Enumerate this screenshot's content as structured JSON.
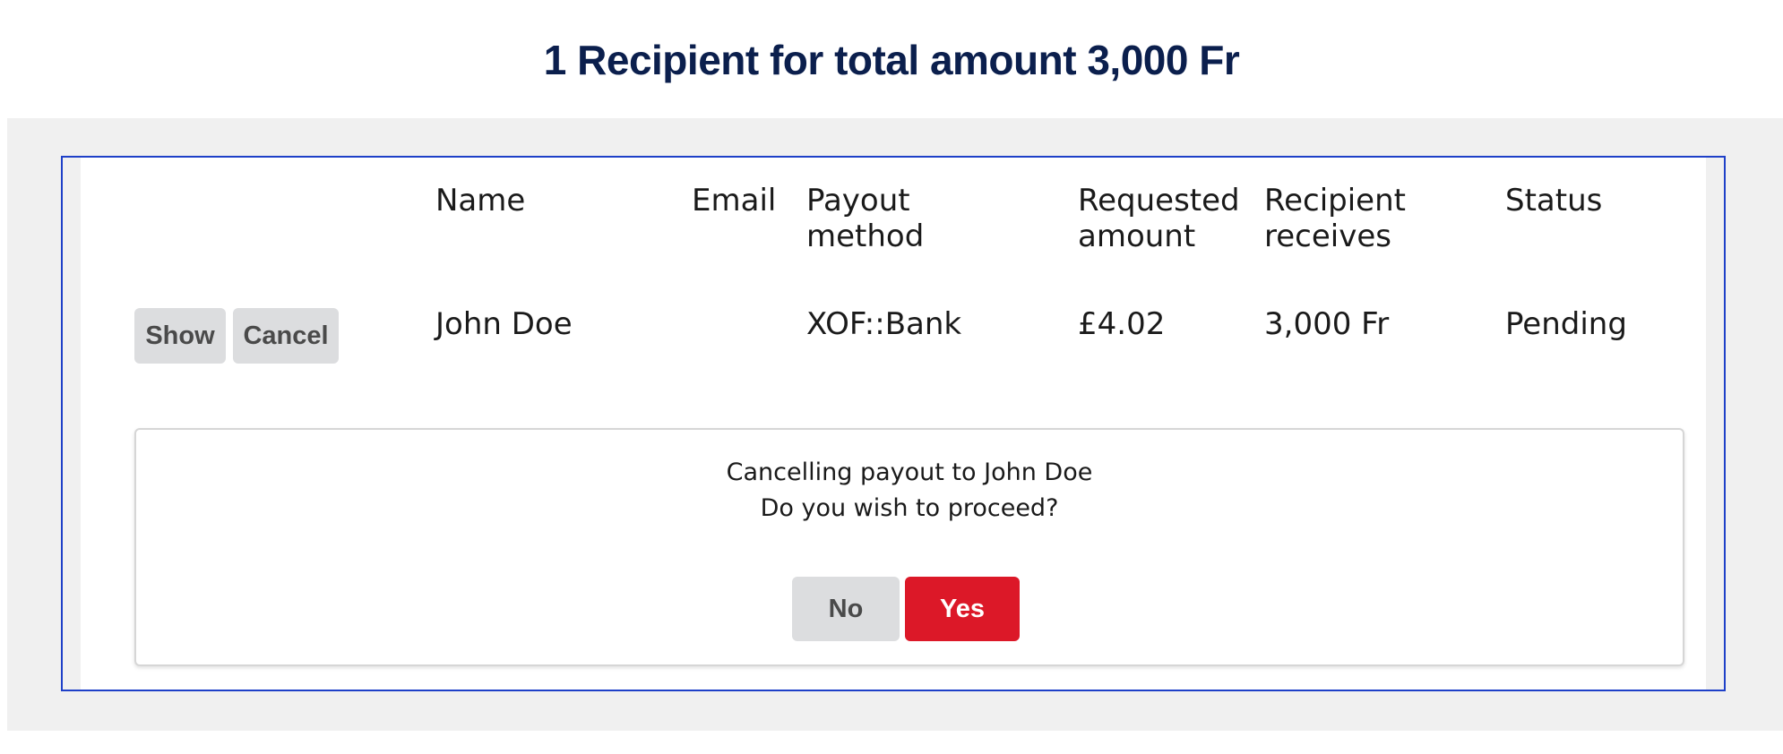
{
  "header": {
    "title": "1 Recipient for total amount 3,000 Fr"
  },
  "table": {
    "columns": {
      "name": "Name",
      "email": "Email",
      "payout_method": [
        "Payout",
        "method"
      ],
      "requested_amount": [
        "Requested",
        "amount"
      ],
      "recipient_receives": [
        "Recipient",
        "receives"
      ],
      "status": "Status"
    },
    "rows": [
      {
        "actions": {
          "show_label": "Show",
          "cancel_label": "Cancel"
        },
        "name": "John Doe",
        "email": "",
        "payout_method": "XOF::Bank",
        "requested_amount": "£4.02",
        "recipient_receives": "3,000 Fr",
        "status": "Pending"
      }
    ]
  },
  "confirm": {
    "message_line1": "Cancelling payout to John Doe",
    "message_line2": "Do you wish to proceed?",
    "no_label": "No",
    "yes_label": "Yes"
  },
  "colors": {
    "title": "#0b1f4d",
    "panel_border": "#1e40c8",
    "yes_button": "#dc1828",
    "neutral_button": "#dcdddf",
    "background_band": "#f0f0f0"
  }
}
